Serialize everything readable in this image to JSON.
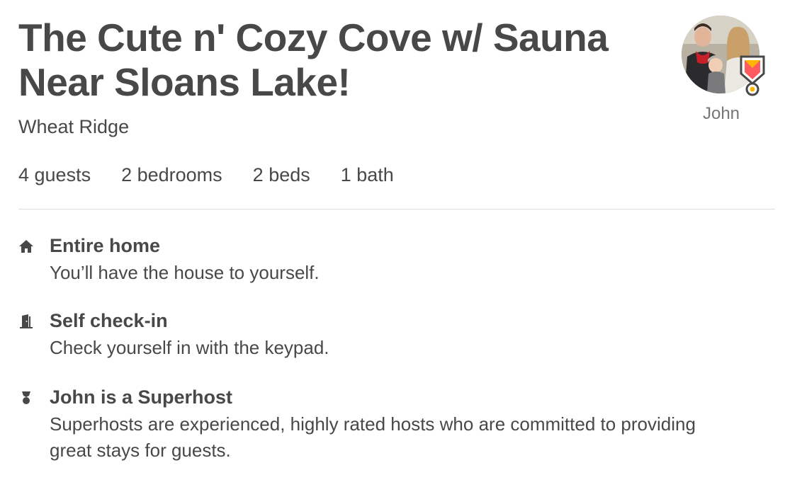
{
  "listing": {
    "title": "The Cute n' Cozy Cove w/ Sauna Near Sloans Lake!",
    "location": "Wheat Ridge"
  },
  "host": {
    "name": "John",
    "avatar_icon": "host-photo",
    "badge_icon": "superhost-badge-icon",
    "badge_color": "#FF5A5F"
  },
  "stats": {
    "guests": "4 guests",
    "bedrooms": "2 bedrooms",
    "beds": "2 beds",
    "baths": "1 bath"
  },
  "features": [
    {
      "icon": "home-icon",
      "title": "Entire home",
      "description": "You’ll have the house to yourself."
    },
    {
      "icon": "door-icon",
      "title": "Self check-in",
      "description": "Check yourself in with the keypad."
    },
    {
      "icon": "medal-icon",
      "title": "John is a Superhost",
      "description": "Superhosts are experienced, highly rated hosts who are committed to providing great stays for guests."
    }
  ],
  "colors": {
    "text": "#484848",
    "muted": "#767676",
    "divider": "#DDDDDD"
  }
}
